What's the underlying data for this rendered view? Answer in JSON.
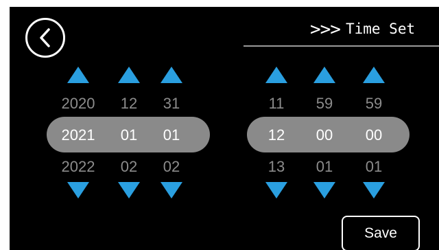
{
  "header": {
    "chevrons": ">>>",
    "title": "Time Set"
  },
  "icons": {
    "back": "chevron-left-icon",
    "up": "triangle-up-icon",
    "down": "triangle-down-icon"
  },
  "date": {
    "year": {
      "prev": "2020",
      "current": "2021",
      "next": "2022"
    },
    "month": {
      "prev": "12",
      "current": "01",
      "next": "02"
    },
    "day": {
      "prev": "31",
      "current": "01",
      "next": "02"
    }
  },
  "time": {
    "hour": {
      "prev": "11",
      "current": "12",
      "next": "13"
    },
    "minute": {
      "prev": "59",
      "current": "00",
      "next": "01"
    },
    "second": {
      "prev": "59",
      "current": "00",
      "next": "01"
    }
  },
  "save_label": "Save",
  "colors": {
    "accent": "#2a9fe0",
    "highlight": "#8a8a8a",
    "background": "#000000",
    "dim_text": "#8c8c8c"
  }
}
